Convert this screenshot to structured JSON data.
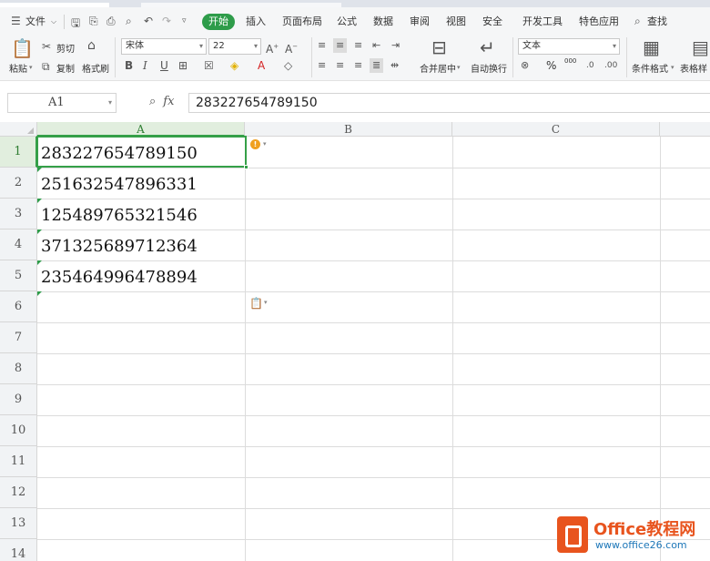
{
  "menubar": {
    "file_label": "文件",
    "active_tab": "开始",
    "tabs": [
      "插入",
      "页面布局",
      "公式",
      "数据",
      "审阅",
      "视图",
      "安全",
      "开发工具",
      "特色应用"
    ],
    "search_label": "查找"
  },
  "ribbon": {
    "paste_label": "粘贴",
    "cut_label": "剪切",
    "copy_label": "复制",
    "format_painter_label": "格式刷",
    "font_name": "宋体",
    "font_size": "22",
    "merge_center_label": "合并居中",
    "wrap_text_label": "自动换行",
    "number_format": "文本",
    "percent_symbol": "%",
    "thousands_label": "000",
    "conditional_format_label": "条件格式",
    "table_style_label": "表格样"
  },
  "formula_bar": {
    "name_box": "A1",
    "fx_label": "fx",
    "value": "283227654789150"
  },
  "grid": {
    "columns": [
      "A",
      "B",
      "C"
    ],
    "rows": [
      "1",
      "2",
      "3",
      "4",
      "5",
      "6",
      "7",
      "8",
      "9",
      "10",
      "11",
      "12",
      "13",
      "14"
    ],
    "cells_A": [
      "283227654789150",
      "251632547896331",
      "125489765321546",
      "371325689712364",
      "235464996478894"
    ]
  },
  "watermark": {
    "title": "Office教程网",
    "url": "www.office26.com"
  }
}
